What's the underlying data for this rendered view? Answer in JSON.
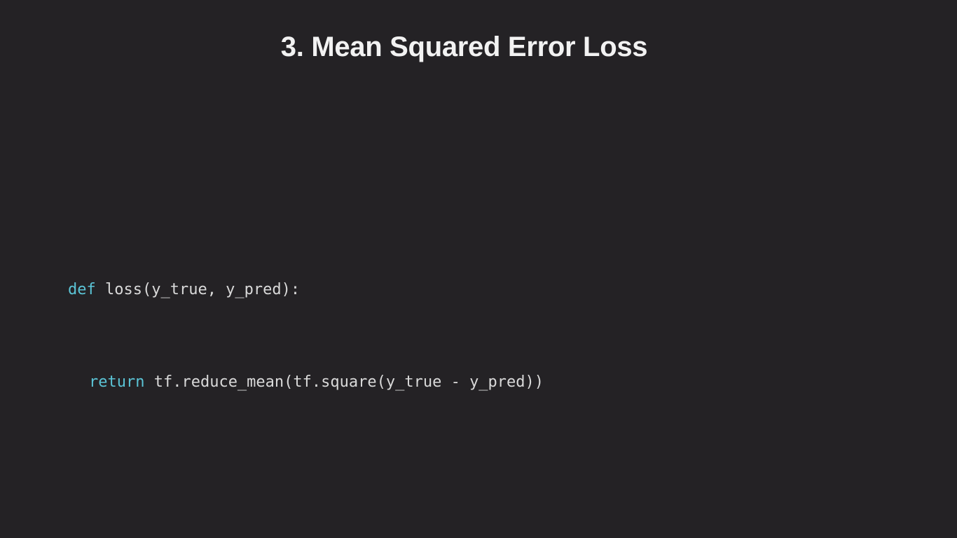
{
  "slide": {
    "title": "3. Mean Squared Error Loss"
  },
  "code": {
    "line1": {
      "keyword": "def",
      "rest": " loss(y_true, y_pred):"
    },
    "line2": {
      "keyword": "return",
      "rest": " tf.reduce_mean(tf.square(y_true - y_pred))"
    }
  },
  "colors": {
    "background": "#242225",
    "keyword": "#5bc4d6",
    "text": "#d9d9d9",
    "title": "#f2f2f2"
  }
}
